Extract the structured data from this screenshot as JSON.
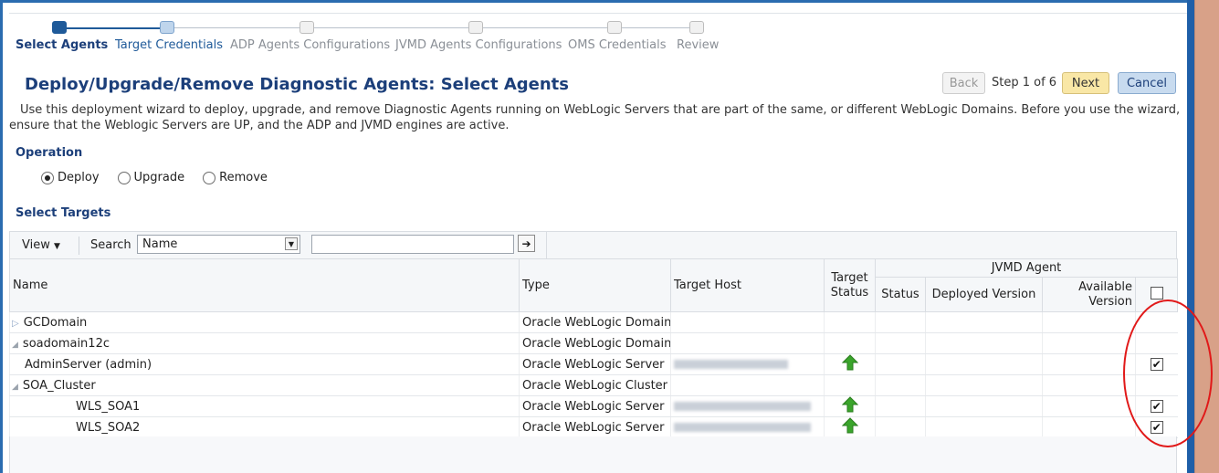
{
  "train": {
    "steps": [
      {
        "label": "Select Agents",
        "state": "active"
      },
      {
        "label": "Target Credentials",
        "state": "link"
      },
      {
        "label": "ADP Agents Configurations",
        "state": "off"
      },
      {
        "label": "JVMD Agents Configurations",
        "state": "off"
      },
      {
        "label": "OMS Credentials",
        "state": "off"
      },
      {
        "label": "Review",
        "state": "off"
      }
    ]
  },
  "header": {
    "title": "Deploy/Upgrade/Remove Diagnostic Agents: Select Agents",
    "back_label": "Back",
    "step_text": "Step 1 of 6",
    "next_label": "Next",
    "cancel_label": "Cancel"
  },
  "description": "Use this deployment wizard to deploy, upgrade, and remove Diagnostic Agents running on WebLogic Servers that are part of the same, or different WebLogic Domains. Before you use the wizard, ensure that the Weblogic Servers are UP, and the ADP and JVMD engines are active.",
  "operation": {
    "heading": "Operation",
    "options": [
      "Deploy",
      "Upgrade",
      "Remove"
    ],
    "selected": "Deploy"
  },
  "targets": {
    "heading": "Select Targets",
    "view_label": "View",
    "search_label": "Search",
    "search_field": "Name",
    "search_value": ""
  },
  "table": {
    "columns": {
      "name": "Name",
      "type": "Type",
      "host": "Target Host",
      "target_status": "Target Status",
      "group": "JVMD Agent",
      "status": "Status",
      "deployed": "Deployed Version",
      "available": "Available Version"
    },
    "rows": [
      {
        "name": "GCDomain",
        "type": "Oracle WebLogic Domain",
        "level": 0,
        "expander": "collapsed",
        "host": false,
        "up": false,
        "checked": null
      },
      {
        "name": "soadomain12c",
        "type": "Oracle WebLogic Domain",
        "level": 0,
        "expander": "expanded",
        "host": false,
        "up": false,
        "checked": null
      },
      {
        "name": "AdminServer (admin)",
        "type": "Oracle WebLogic Server",
        "level": 1,
        "expander": "none",
        "host": true,
        "up": true,
        "checked": true
      },
      {
        "name": "SOA_Cluster",
        "type": "Oracle WebLogic Cluster",
        "level": 1,
        "expander": "expanded",
        "host": false,
        "up": false,
        "checked": null
      },
      {
        "name": "WLS_SOA1",
        "type": "Oracle WebLogic Server",
        "level": 2,
        "expander": "none",
        "host": true,
        "up": true,
        "checked": true
      },
      {
        "name": "WLS_SOA2",
        "type": "Oracle WebLogic Server",
        "level": 2,
        "expander": "none",
        "host": true,
        "up": true,
        "checked": true
      }
    ]
  },
  "colors": {
    "accent": "#1c3f7a",
    "status_up": "#3aa52b",
    "highlight_circle": "#e11919"
  }
}
